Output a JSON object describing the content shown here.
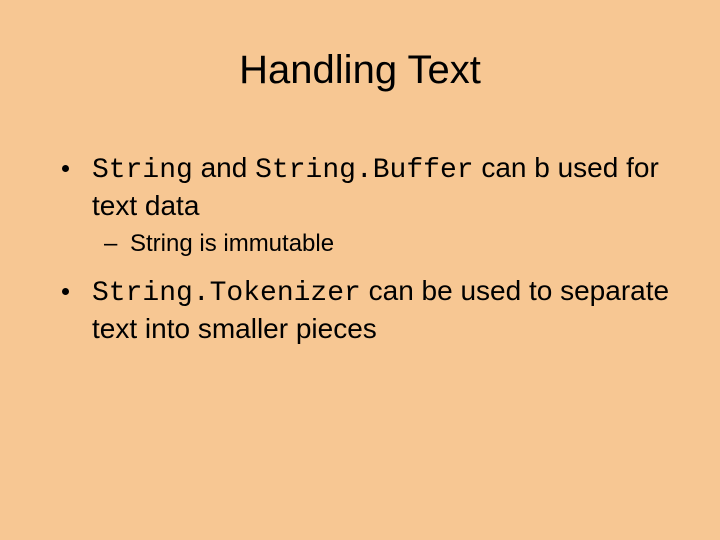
{
  "title": "Handling Text",
  "bullets": {
    "b1": {
      "code1": "String",
      "mid1": " and ",
      "code2": "String.Buffer",
      "tail": " can b used for text data"
    },
    "b1_sub": {
      "dash": "–",
      "text": "String is immutable"
    },
    "b2": {
      "code1": "String.Tokenizer",
      "tail": " can be used to separate text into smaller pieces"
    }
  }
}
